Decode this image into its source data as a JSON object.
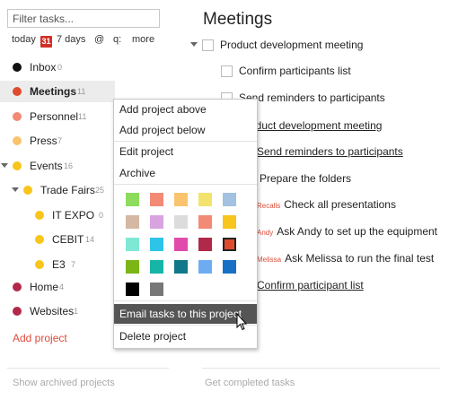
{
  "filter": {
    "placeholder": "Filter tasks..."
  },
  "quick_links": {
    "today": "today",
    "today_badge": "31",
    "next7": "7 days",
    "at": "@",
    "q": "q:",
    "more": "more"
  },
  "projects": [
    {
      "name": "Inbox",
      "count": "0",
      "color": "#111111"
    },
    {
      "name": "Meetings",
      "count": "11",
      "color": "#e04b2d"
    },
    {
      "name": "Personnel",
      "count": "11",
      "color": "#f28a76"
    },
    {
      "name": "Press",
      "count": "7",
      "color": "#fac36e"
    },
    {
      "name": "Events",
      "count": "16",
      "color": "#f7c51b"
    },
    {
      "name": "Trade Fairs",
      "count": "25",
      "color": "#f7c51b"
    },
    {
      "name": "IT EXPO",
      "count": "0",
      "color": "#f7c51b"
    },
    {
      "name": "CEBIT",
      "count": "14",
      "color": "#f7c51b"
    },
    {
      "name": "E3",
      "count": "7",
      "color": "#f7c51b"
    },
    {
      "name": "Home",
      "count": "4",
      "color": "#b1294a"
    },
    {
      "name": "Websites",
      "count": "1",
      "color": "#b1294a"
    }
  ],
  "add_project": "Add project",
  "show_archived": "Show archived projects",
  "main": {
    "title": "Meetings",
    "tasks": [
      {
        "text": "Product development meeting",
        "tag": ""
      },
      {
        "text": "Confirm participants list",
        "tag": ""
      },
      {
        "text": "Send reminders to participants",
        "tag": ""
      },
      {
        "text": "Product development meeting",
        "tag": ""
      },
      {
        "text": "Send reminders to participants",
        "tag": ""
      },
      {
        "text": "Prepare the folders",
        "tag": ""
      },
      {
        "text": "Check all presentations",
        "tag": "Recalls"
      },
      {
        "text": "Ask Andy to set up the equipment",
        "tag": "Andy"
      },
      {
        "text": "Ask Melissa to run the final test",
        "tag": "Melissa"
      },
      {
        "text": "Confirm participant list",
        "tag": ""
      }
    ],
    "get_completed": "Get completed tasks"
  },
  "menu": {
    "add_above": "Add project above",
    "add_below": "Add project below",
    "edit": "Edit project",
    "archive": "Archive",
    "email": "Email tasks to this project",
    "delete": "Delete project",
    "colors": [
      "#8cdd5e",
      "#f28a76",
      "#fac36e",
      "#f2e36e",
      "#a3c1e0",
      "#d4b8a3",
      "#d9a3e0",
      "#dcdcdc",
      "#f28a76",
      "#f7c51b",
      "#7ee8d4",
      "#2ec4e8",
      "#e04bac",
      "#b1294a",
      "#e04b2d",
      "#7cb516",
      "#16b5a8",
      "#10788a",
      "#6eacf2",
      "#1670c4",
      "#000000",
      "#777777"
    ],
    "selected_color": "#e04b2d"
  }
}
